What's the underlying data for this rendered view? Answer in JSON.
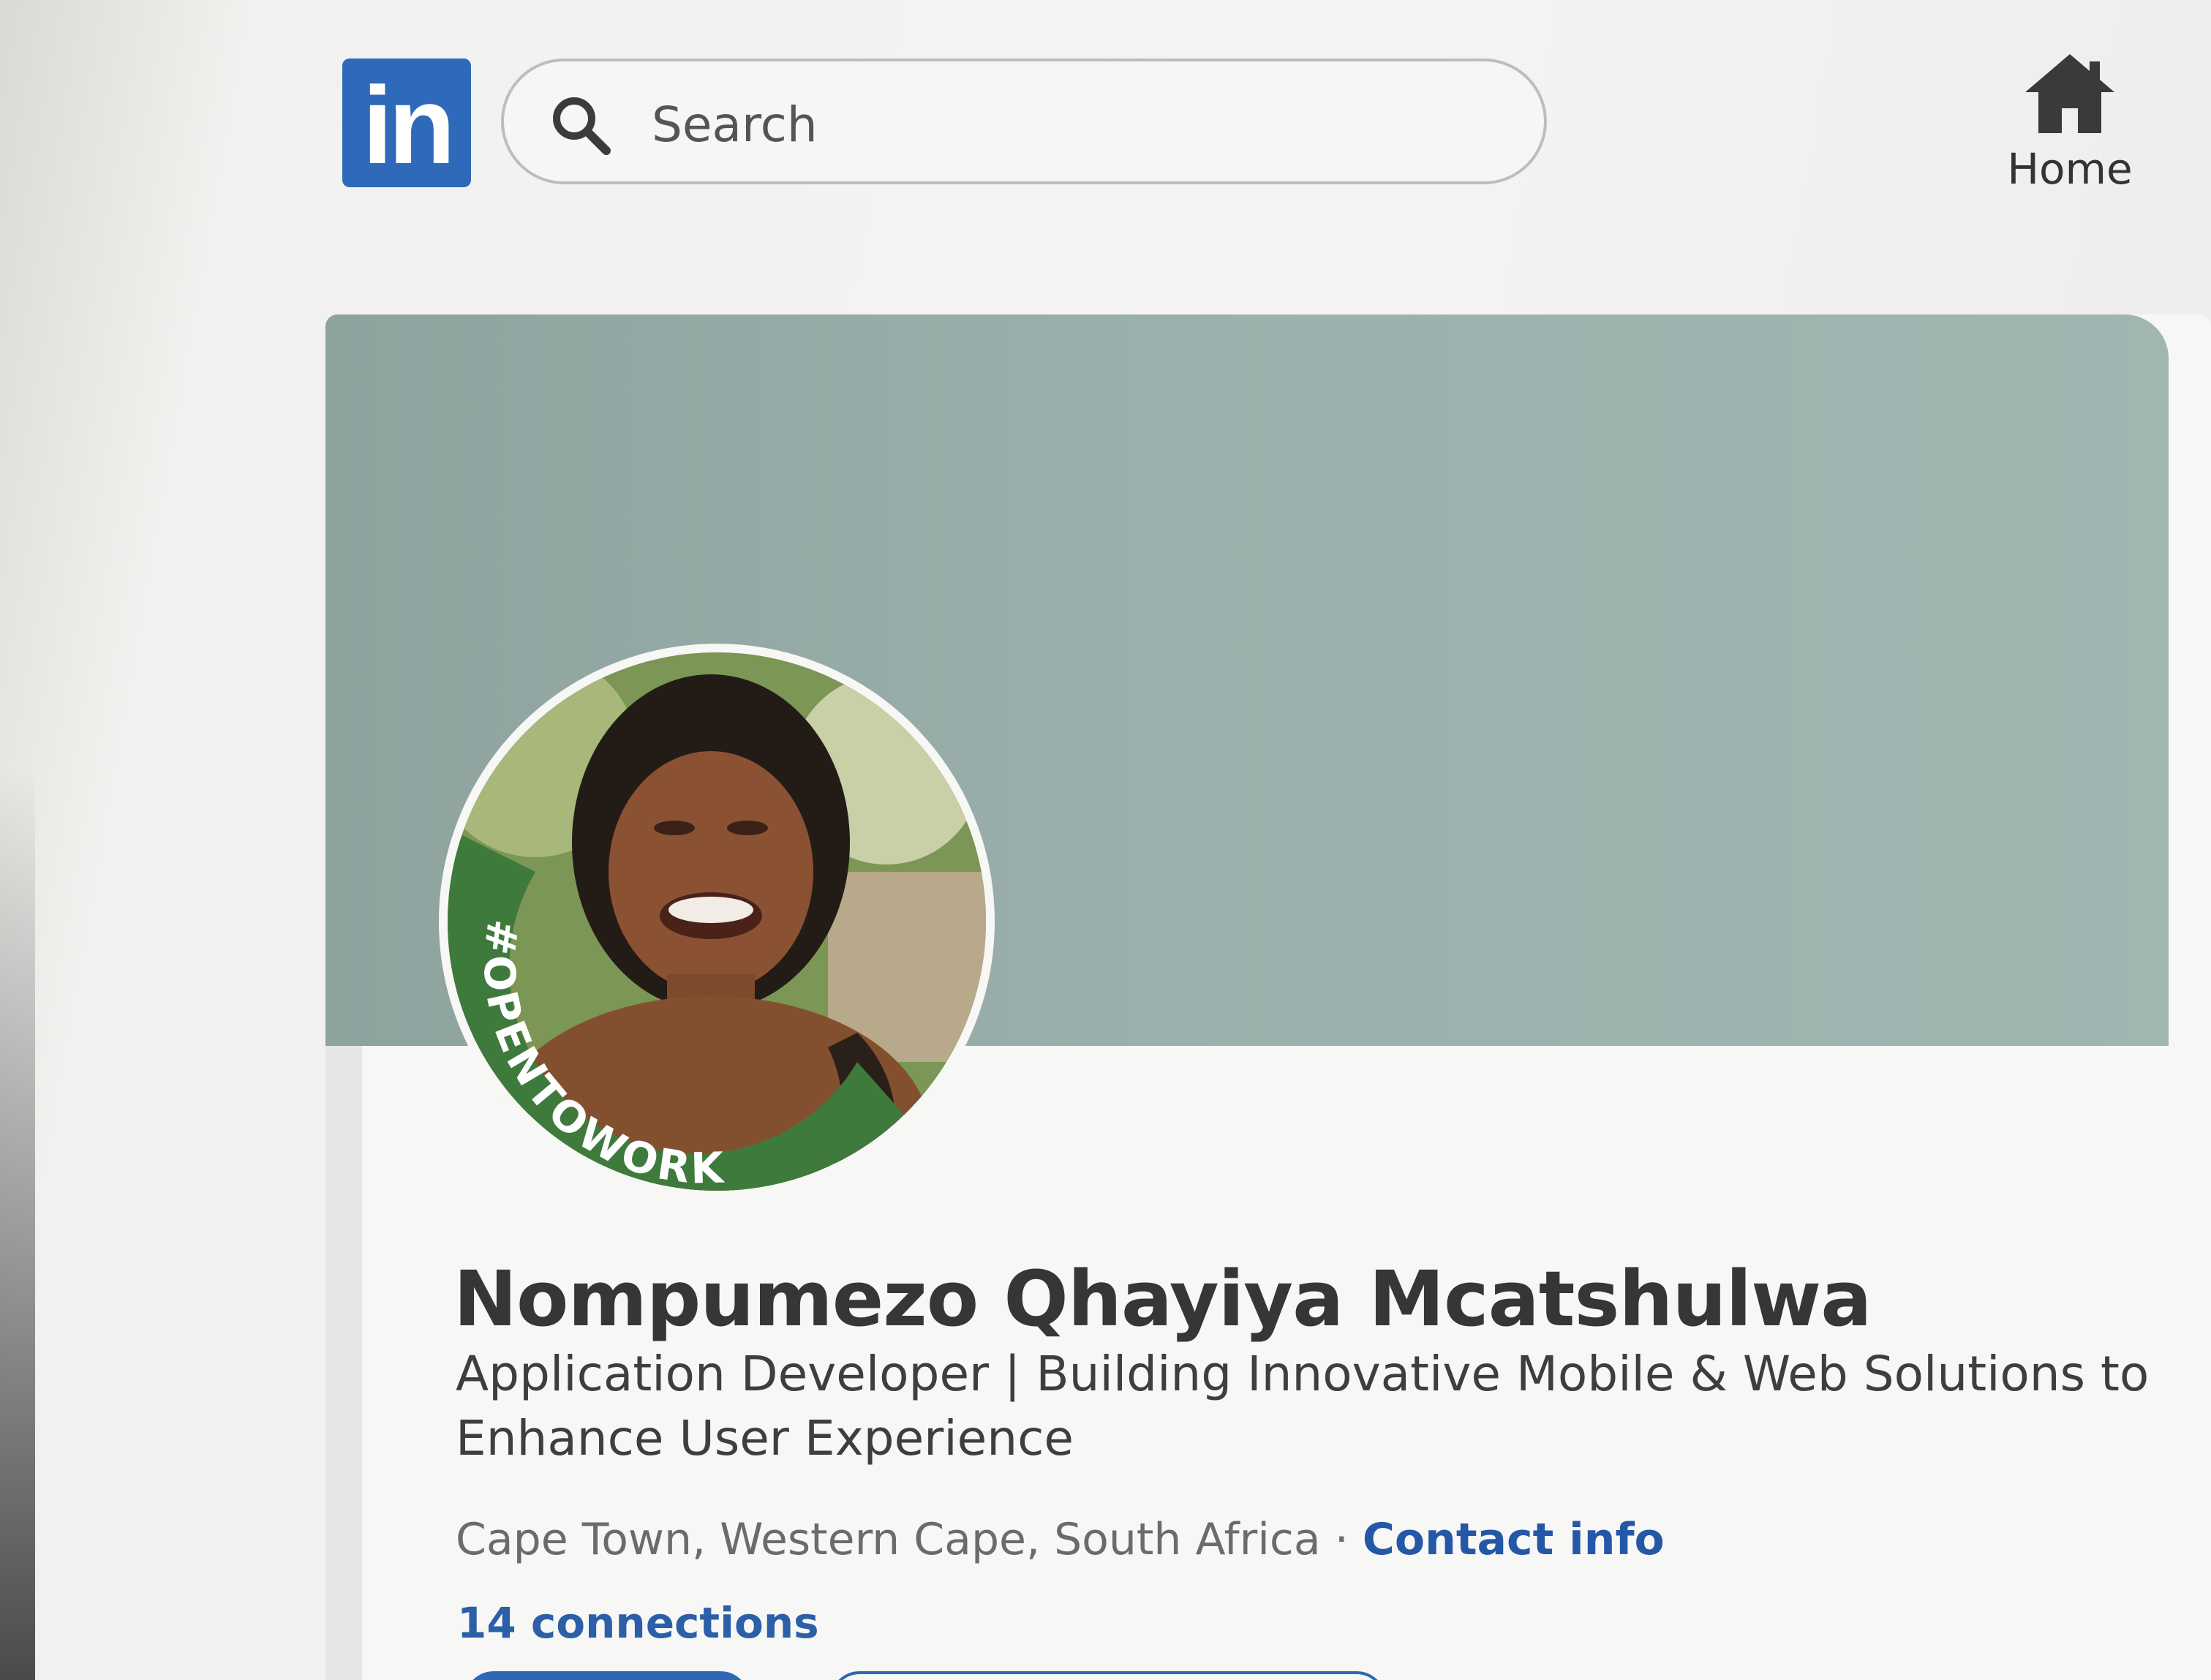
{
  "header": {
    "logo_text": "in",
    "search": {
      "placeholder": "Search"
    },
    "nav": {
      "home_label": "Home"
    }
  },
  "profile": {
    "name": "Nompumezo Qhayiya Mcatshulwa",
    "headline": "Application Developer | Building Innovative Mobile & Web Solutions to Enhance User Experience",
    "location": "Cape Town, Western Cape, South Africa",
    "separator": "·",
    "contact_info_label": "Contact info",
    "connections_label": "14 connections",
    "open_to_work_badge": "#OPENTOWORK"
  },
  "colors": {
    "brand_blue": "#2f69ba",
    "banner": "#9bb0ac",
    "open_to_work_green": "#3f7a3d",
    "link_blue": "#2557a7"
  },
  "icons": {
    "search": "search-icon",
    "home": "home-icon"
  }
}
